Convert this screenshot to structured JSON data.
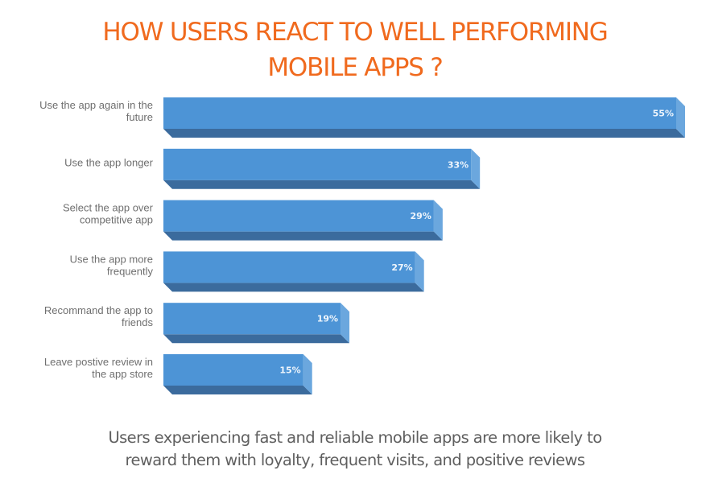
{
  "chart_data": {
    "type": "bar",
    "orientation": "horizontal",
    "title": "HOW USERS REACT TO WELL PERFORMING MOBILE APPS ?",
    "title_lines": [
      "HOW USERS REACT TO WELL PERFORMING",
      "MOBILE APPS ?"
    ],
    "categories": [
      "Use the app again in the future",
      "Use the app longer",
      "Select the app over competitive app",
      "Use the app more frequently",
      "Recommand the app to friends",
      "Leave postive review in the app store"
    ],
    "category_lines": [
      [
        "Use the app again in the",
        "future"
      ],
      [
        "Use the app longer"
      ],
      [
        "Select the app over",
        "competitive app"
      ],
      [
        "Use the app more",
        "frequently"
      ],
      [
        "Recommand the app to",
        "friends"
      ],
      [
        "Leave postive review in",
        "the app store"
      ]
    ],
    "values": [
      55,
      33,
      29,
      27,
      19,
      15
    ],
    "value_labels": [
      "55%",
      "33%",
      "29%",
      "27%",
      "19%",
      "15%"
    ],
    "unit": "%",
    "xlim": [
      0,
      55
    ],
    "grid": false,
    "legend": "none",
    "xlabel": "",
    "ylabel": "",
    "colors": {
      "bar_front": "#4d94d6",
      "bar_side": "#6ba7de",
      "bar_bottom": "#3b6b9d",
      "title": "#f06a1e",
      "category_text": "#6f6f6f",
      "value_text": "#eef5fc"
    }
  },
  "caption_lines": [
    "Users experiencing fast and reliable mobile apps are more likely to",
    "reward them with loyalty, frequent visits, and positive reviews"
  ]
}
